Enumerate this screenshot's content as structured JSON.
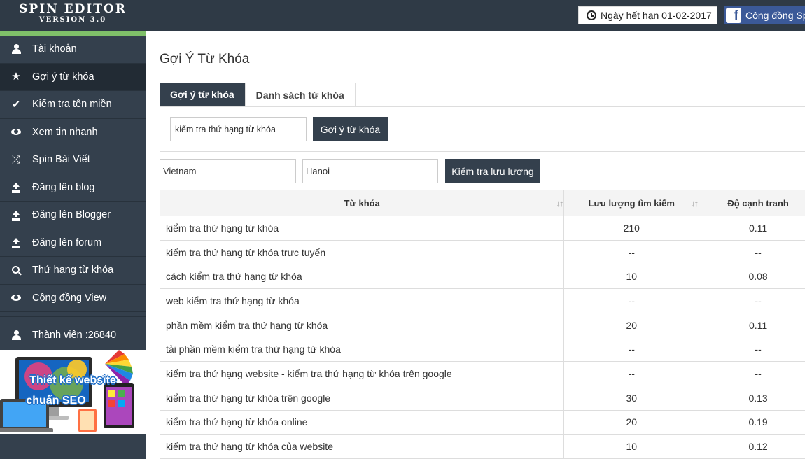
{
  "brand": {
    "title": "SPIN EDITOR",
    "version": "VERSION 3.0"
  },
  "header": {
    "expiry_text": "Ngày hết hạn 01-02-2017",
    "community_text": "Cộng đồng Spin",
    "icons": [
      "clock-icon",
      "facebook-icon"
    ]
  },
  "sidebar": {
    "items": [
      {
        "label": "Tài khoản",
        "icon": "user-icon",
        "active": false
      },
      {
        "label": "Gợi ý từ khóa",
        "icon": "star-icon",
        "active": true
      },
      {
        "label": "Kiểm tra tên miền",
        "icon": "check-icon",
        "active": false
      },
      {
        "label": "Xem tin nhanh",
        "icon": "eye-icon",
        "active": false
      },
      {
        "label": "Spin Bài Viết",
        "icon": "shuffle-icon",
        "active": false
      },
      {
        "label": "Đăng lên blog",
        "icon": "upload-icon",
        "active": false
      },
      {
        "label": "Đăng lên Blogger",
        "icon": "upload-icon",
        "active": false
      },
      {
        "label": "Đăng lên forum",
        "icon": "upload-icon",
        "active": false
      },
      {
        "label": "Thứ hạng từ khóa",
        "icon": "search-icon",
        "active": false
      },
      {
        "label": "Cộng đồng View",
        "icon": "eye-icon",
        "active": false
      }
    ],
    "member_label": "Thành viên :26840",
    "banner_text": [
      "Thiết kế website",
      "chuẩn SEO"
    ]
  },
  "main": {
    "title": "Gợi Ý Từ Khóa",
    "tabs": [
      {
        "label": "Gợi ý từ khóa",
        "active": true
      },
      {
        "label": "Danh sách từ khóa",
        "active": false
      }
    ],
    "keyword_input_value": "kiểm tra thứ hạng từ khóa",
    "suggest_button": "Gợi ý từ khóa",
    "country_value": "Vietnam",
    "city_value": "Hanoi",
    "traffic_button": "Kiểm tra lưu lượng"
  },
  "table": {
    "headers": [
      "Từ khóa",
      "Lưu lượng tìm kiếm",
      "Độ cạnh tranh"
    ],
    "rows": [
      [
        "kiểm tra thứ hạng từ khóa",
        "210",
        "0.11"
      ],
      [
        "kiểm tra thứ hạng từ khóa trực tuyến",
        "--",
        "--"
      ],
      [
        "cách kiểm tra thứ hạng từ khóa",
        "10",
        "0.08"
      ],
      [
        "web kiểm tra thứ hạng từ khóa",
        "--",
        "--"
      ],
      [
        "phần mềm kiểm tra thứ hạng từ khóa",
        "20",
        "0.11"
      ],
      [
        "tải phần mềm kiểm tra thứ hạng từ khóa",
        "--",
        "--"
      ],
      [
        "kiểm tra thứ hạng website - kiểm tra thứ hạng từ khóa trên google",
        "--",
        "--"
      ],
      [
        "kiểm tra thứ hạng từ khóa trên google",
        "30",
        "0.13"
      ],
      [
        "kiểm tra thứ hạng từ khóa online",
        "20",
        "0.19"
      ],
      [
        "kiểm tra thứ hạng từ khóa của website",
        "10",
        "0.12"
      ]
    ]
  },
  "colors": {
    "topbar": "#2f3a46",
    "sidebar": "#34404d",
    "sidebar_active": "#222b34",
    "accent_green": "#7fc069",
    "facebook": "#3b5998"
  }
}
